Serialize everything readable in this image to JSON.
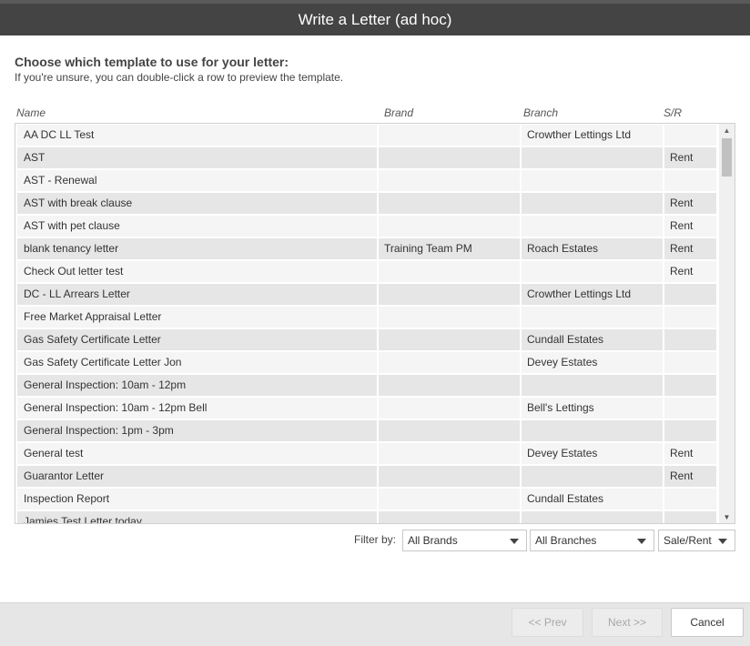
{
  "dialog": {
    "title": "Write a Letter (ad hoc)",
    "heading": "Choose which template to use for your letter:",
    "subheading": "If you're unsure, you can double-click a row to preview the template."
  },
  "columns": {
    "name": "Name",
    "brand": "Brand",
    "branch": "Branch",
    "sr": "S/R"
  },
  "rows": [
    {
      "name": "AA DC LL Test",
      "brand": "",
      "branch": "Crowther Lettings Ltd",
      "sr": ""
    },
    {
      "name": "AST",
      "brand": "",
      "branch": "",
      "sr": "Rent"
    },
    {
      "name": "AST - Renewal",
      "brand": "",
      "branch": "",
      "sr": ""
    },
    {
      "name": "AST with break clause",
      "brand": "",
      "branch": "",
      "sr": "Rent"
    },
    {
      "name": "AST with pet clause",
      "brand": "",
      "branch": "",
      "sr": "Rent"
    },
    {
      "name": "blank tenancy letter",
      "brand": "Training Team PM",
      "branch": "Roach Estates",
      "sr": "Rent"
    },
    {
      "name": "Check Out letter test",
      "brand": "",
      "branch": "",
      "sr": "Rent"
    },
    {
      "name": "DC - LL Arrears Letter",
      "brand": "",
      "branch": "Crowther Lettings Ltd",
      "sr": ""
    },
    {
      "name": "Free Market Appraisal Letter",
      "brand": "",
      "branch": "",
      "sr": ""
    },
    {
      "name": "Gas Safety Certificate Letter",
      "brand": "",
      "branch": "Cundall Estates",
      "sr": ""
    },
    {
      "name": "Gas Safety Certificate Letter Jon",
      "brand": "",
      "branch": "Devey Estates",
      "sr": ""
    },
    {
      "name": "General Inspection: 10am - 12pm",
      "brand": "",
      "branch": "",
      "sr": ""
    },
    {
      "name": "General Inspection: 10am - 12pm Bell",
      "brand": "",
      "branch": "Bell's Lettings",
      "sr": ""
    },
    {
      "name": "General Inspection: 1pm - 3pm",
      "brand": "",
      "branch": "",
      "sr": ""
    },
    {
      "name": "General test",
      "brand": "",
      "branch": "Devey Estates",
      "sr": "Rent"
    },
    {
      "name": "Guarantor Letter",
      "brand": "",
      "branch": "",
      "sr": "Rent"
    },
    {
      "name": "Inspection Report",
      "brand": "",
      "branch": "Cundall Estates",
      "sr": ""
    },
    {
      "name": "Jamies Test Letter today",
      "brand": "",
      "branch": "",
      "sr": ""
    }
  ],
  "filter": {
    "label": "Filter by:",
    "brand_value": "All Brands",
    "branch_value": "All Branches",
    "salerent_value": "Sale/Rent"
  },
  "buttons": {
    "prev": "<< Prev",
    "next": "Next >>",
    "cancel": "Cancel"
  },
  "icons": {
    "scroll_up": "chevron-up-icon",
    "scroll_down": "chevron-down-icon",
    "caret": "caret-down-icon"
  },
  "colors": {
    "titlebar": "#444444",
    "row_light": "#f5f5f5",
    "row_dark": "#e6e6e6"
  }
}
